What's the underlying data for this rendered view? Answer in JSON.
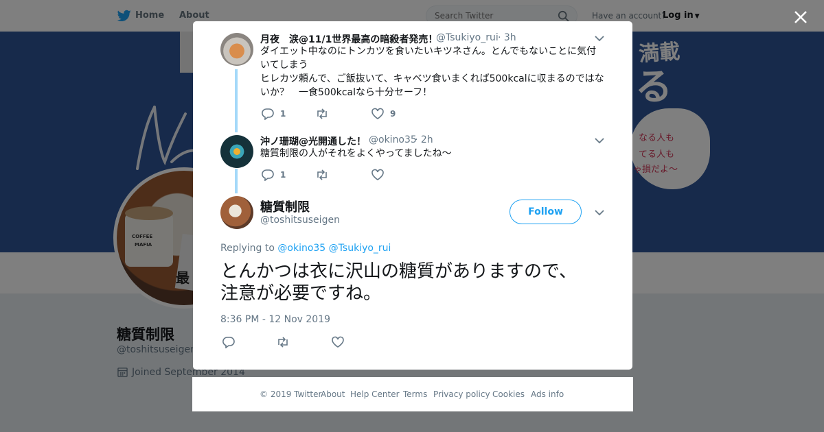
{
  "nav": {
    "home_label": "Home",
    "about_label": "About",
    "search_placeholder": "Search Twitter",
    "have_account": "Have an account?",
    "login_label": "Log in"
  },
  "banner": {
    "line1": "満載",
    "line2": "る",
    "cloud1": "なる人も",
    "cloud2": "てる人も",
    "cloud3": "ゃ損だよ〜",
    "script": "We"
  },
  "profile": {
    "name": "糖質制限",
    "handle": "@toshitsuseigen",
    "joined": "Joined September 2014",
    "mug1": "COFFEE",
    "mug2": "MAFIA",
    "book": "最"
  },
  "modal": {
    "tweets": [
      {
        "name": "月夜　涙@11/1世界最高の暗殺者発売！",
        "handle": "@Tsukiyo_rui",
        "time": "· 3h",
        "text1": "ダイエット中なのにトンカツを食いたいキツネさん。とんでもないことに気付",
        "text2": "いてしまう",
        "text3": "ヒレカツ頼んで、ご飯抜いて、キャベツ食いまくれば500kcalに収まるのではな",
        "text4": "いか？　一食500kcalなら十分セーフ！",
        "replies": "1",
        "likes": "9"
      },
      {
        "name": "沖ノ珊瑚@光開通した！",
        "handle": "@okino35",
        "time": "· 2h",
        "text": "糖質制限の人がそれをよくやってましたね〜",
        "replies": "1"
      }
    ],
    "main": {
      "name": "糖質制限",
      "handle": "@toshitsuseigen",
      "follow_label": "Follow",
      "replying_prefix": "Replying to",
      "reply_to_1": "@okino35",
      "reply_to_2": "@Tsukiyo_rui",
      "text_line1": "とんかつは衣に沢山の糖質がありますので、",
      "text_line2": "注意が必要ですね。",
      "timestamp": "8:36 PM - 12 Nov 2019"
    }
  },
  "footer": {
    "copyright": "© 2019 Twitter",
    "about": "About",
    "help": "Help Center",
    "terms": "Terms",
    "privacy": "Privacy policy",
    "cookies": "Cookies",
    "ads": "Ads info"
  },
  "colors": {
    "twitter_blue": "#1da1f2",
    "thread_line": "#a4d9f9",
    "banner_blue": "#2f5597"
  }
}
